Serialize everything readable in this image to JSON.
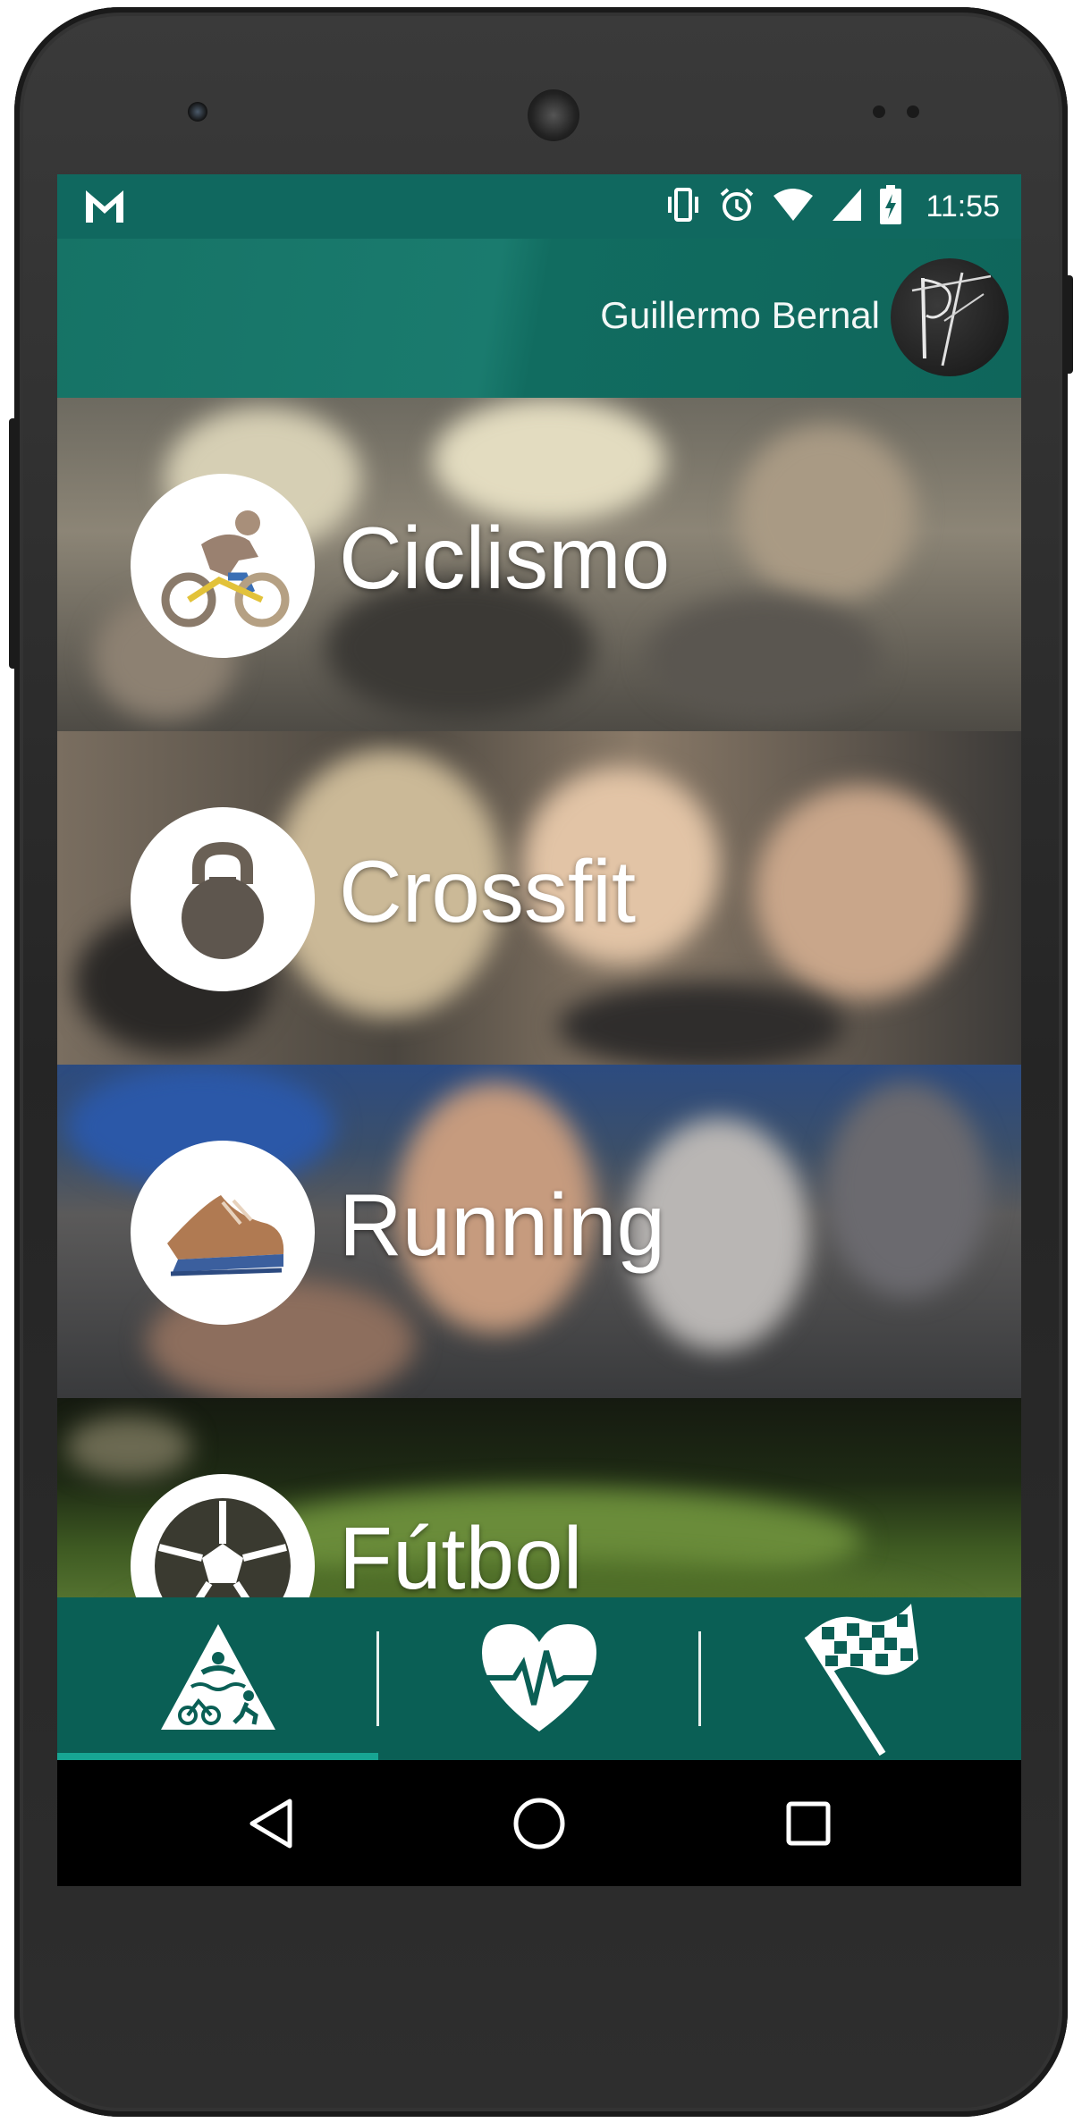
{
  "status_bar": {
    "time": "11:55",
    "icons": [
      "gmail-icon",
      "vibrate-icon",
      "alarm-icon",
      "wifi-icon",
      "signal-icon",
      "battery-charging-icon"
    ]
  },
  "header": {
    "user_name": "Guillermo Bernal",
    "avatar": "avatar-signature"
  },
  "sports": [
    {
      "label": "Ciclismo",
      "icon": "cycling-icon"
    },
    {
      "label": "Crossfit",
      "icon": "kettlebell-icon"
    },
    {
      "label": "Running",
      "icon": "running-shoe-icon"
    },
    {
      "label": "Fútbol",
      "icon": "soccer-ball-icon"
    }
  ],
  "tabs": [
    {
      "name": "triathlon",
      "icon": "triathlon-icon",
      "selected": true
    },
    {
      "name": "health",
      "icon": "heart-pulse-icon",
      "selected": false
    },
    {
      "name": "race",
      "icon": "checkered-flag-icon",
      "selected": false
    }
  ],
  "nav": [
    "back-icon",
    "home-icon",
    "recents-icon"
  ],
  "colors": {
    "status_bar": "#10685f",
    "app_bar": "#167366",
    "tab_bar": "#0a5f55",
    "tab_indicator": "#17a593"
  }
}
